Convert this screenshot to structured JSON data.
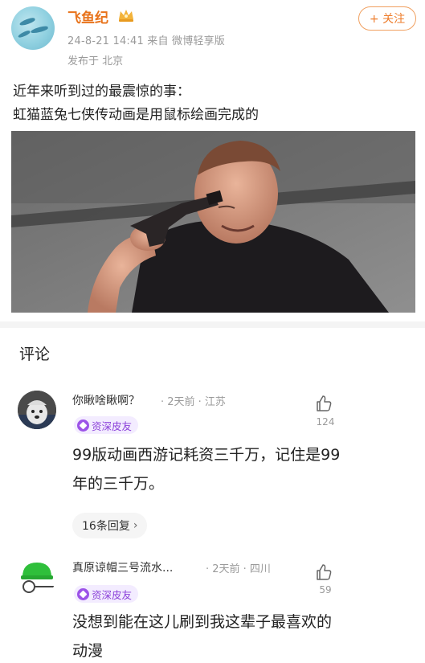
{
  "post": {
    "username": "飞鱼纪",
    "crown_icon": "crown-icon",
    "time_source": "24-8-21 14:41  来自 微博轻享版",
    "location": "发布于 北京",
    "follow_label": "+ 关注",
    "text_lines": [
      "近年来听到过的最震惊的事：",
      "虹猫蓝兔七侠传动画是用鼠标绘画完成的"
    ],
    "image": "photo of a man in dark shirt holding a pistol to his own head, gray background"
  },
  "comments_title": "评论",
  "comments": [
    {
      "name": "你瞅啥瞅啊？",
      "meta": "· 2天前 · 江苏",
      "badge": "资深皮友",
      "likes": "124",
      "body_lines": [
        "99版动画西游记耗资三千万，记住是99",
        "年的三千万。"
      ],
      "reply_label": "16条回复"
    },
    {
      "name": "真原谅帽三号流水...",
      "meta": "· 2天前 · 四川",
      "badge": "资深皮友",
      "likes": "59",
      "body_lines": [
        "没想到能在这儿刷到我这辈子最喜欢的",
        "动漫"
      ]
    }
  ],
  "colors": {
    "username": "#e8731b",
    "follow_border": "#f0a060",
    "badge_text": "#8a3fd9",
    "badge_bg": "#f3ecff",
    "muted": "#9a9a9a"
  }
}
